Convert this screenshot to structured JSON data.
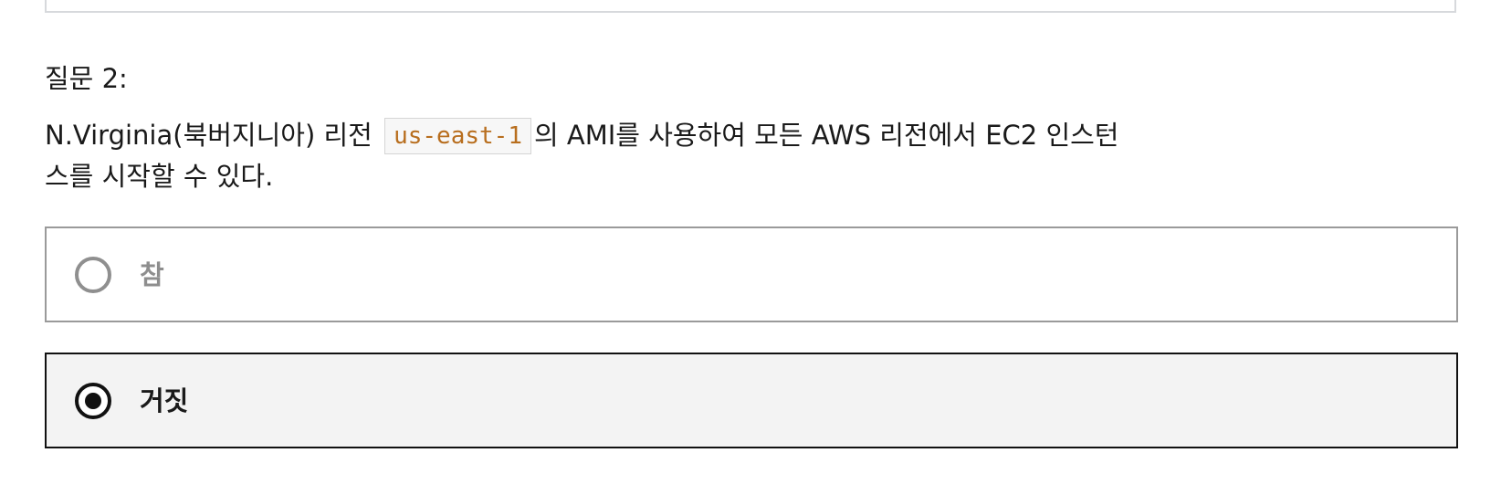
{
  "question": {
    "label": "질문 2:",
    "text_before": "N.Virginia(북버지니아) 리전 ",
    "code": "us-east-1",
    "text_after": "의 AMI를 사용하여 모든 AWS 리전에서 EC2 인스턴스를 시작할 수 있다."
  },
  "options": [
    {
      "label": "참",
      "selected": false
    },
    {
      "label": "거짓",
      "selected": true
    }
  ],
  "colors": {
    "code_text": "#b86e1e",
    "selected_border": "#111111",
    "selected_background": "#f3f3f3",
    "unselected_border": "#9a9a9a",
    "unselected_text": "#8e8e8e"
  }
}
